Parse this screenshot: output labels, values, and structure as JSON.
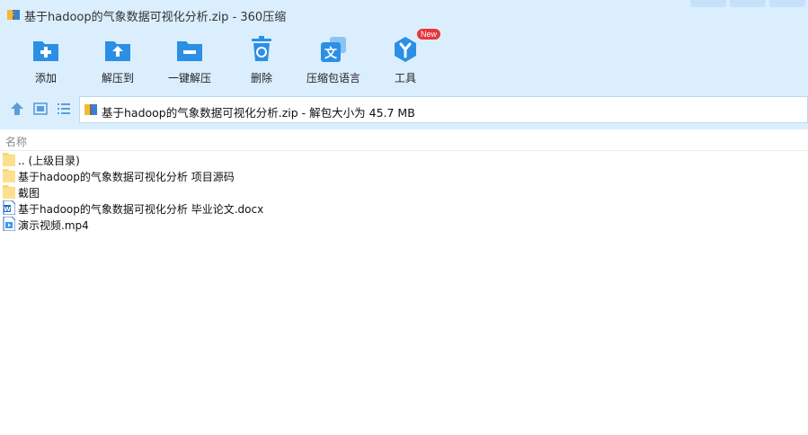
{
  "window": {
    "title": "基于hadoop的气象数据可视化分析.zip - 360压缩"
  },
  "toolbar": {
    "items": [
      {
        "label": "添加",
        "icon": "add-folder-icon"
      },
      {
        "label": "解压到",
        "icon": "extract-to-icon"
      },
      {
        "label": "一键解压",
        "icon": "one-click-extract-icon"
      },
      {
        "label": "删除",
        "icon": "trash-icon"
      },
      {
        "label": "压缩包语言",
        "icon": "language-icon"
      },
      {
        "label": "工具",
        "icon": "tools-icon",
        "badge": "New"
      }
    ]
  },
  "nav": {
    "path": "基于hadoop的气象数据可视化分析.zip - 解包大小为 45.7 MB"
  },
  "list": {
    "header_name": "名称",
    "rows": [
      {
        "name": ".. (上级目录)",
        "type": "folder"
      },
      {
        "name": "基于hadoop的气象数据可视化分析 项目源码",
        "type": "folder"
      },
      {
        "name": "截图",
        "type": "folder"
      },
      {
        "name": "基于hadoop的气象数据可视化分析 毕业论文.docx",
        "type": "docx"
      },
      {
        "name": "演示视频.mp4",
        "type": "video"
      }
    ]
  },
  "colors": {
    "accent": "#2b8fe6",
    "toolbar_bg": "#dbeefe",
    "folder": "#f8d775",
    "badge": "#e8363c"
  }
}
